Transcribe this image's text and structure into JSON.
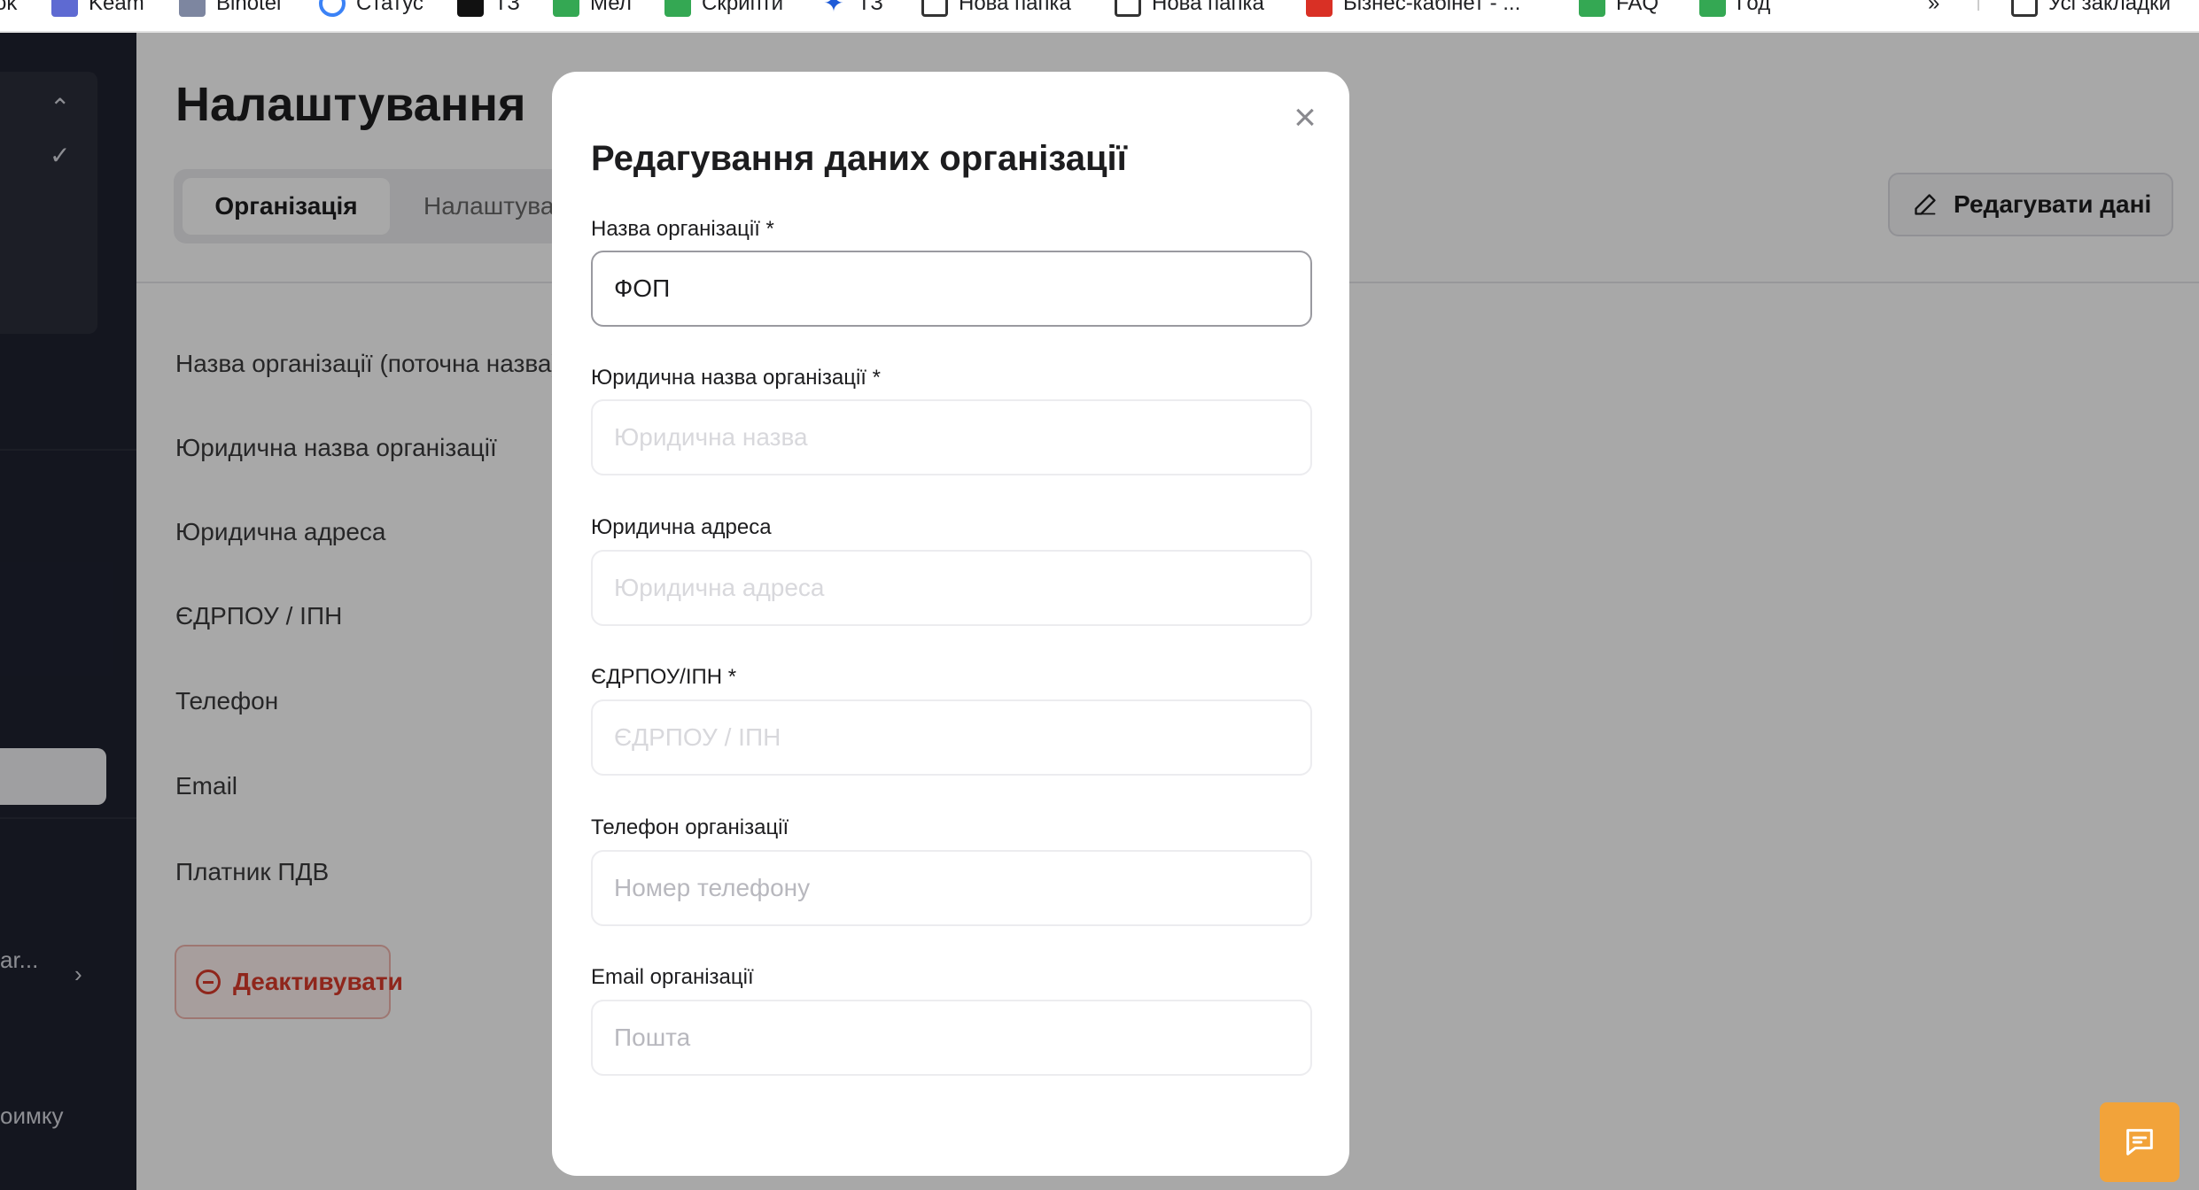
{
  "bookmarks": [
    {
      "label": "ok",
      "icon": "none"
    },
    {
      "label": "Keam",
      "icon": "blue-square-icon"
    },
    {
      "label": "Binotel",
      "icon": "grey-square-icon"
    },
    {
      "label": "Статус",
      "icon": "circle-icon"
    },
    {
      "label": "ТЗ",
      "icon": "black-square-icon"
    },
    {
      "label": "Мел",
      "icon": "green-sheet-icon"
    },
    {
      "label": "Скрипти",
      "icon": "green-sheet-icon"
    },
    {
      "label": "ТЗ",
      "icon": "star-icon"
    },
    {
      "label": "Нова папка",
      "icon": "folder-icon"
    },
    {
      "label": "Нова папка",
      "icon": "folder-icon"
    },
    {
      "label": "Бізнес-кабінет - ...",
      "icon": "red-icon"
    },
    {
      "label": "FAQ",
      "icon": "green-sheet-icon"
    },
    {
      "label": "Год",
      "icon": "green-sheet-icon"
    },
    {
      "label": "»",
      "icon": "none"
    },
    {
      "label": "Усі закладки",
      "icon": "folder-icon"
    }
  ],
  "sidebar": {
    "org_item": "ar...",
    "support_item": "оимку"
  },
  "page": {
    "title": "Налаштування",
    "tabs": [
      "Організація",
      "Налаштування"
    ],
    "edit_button": "Редагувати дані",
    "info_labels": [
      "Назва організації (поточна назва)",
      "Юридична назва організації",
      "Юридична адреса",
      "ЄДРПОУ / ІПН",
      "Телефон",
      "Email",
      "Платник ПДВ"
    ],
    "deactivate_button": "Деактивувати"
  },
  "modal": {
    "title": "Редагування даних організації",
    "close": "×",
    "fields": [
      {
        "label": "Назва організації *",
        "value": "ФОП",
        "placeholder": ""
      },
      {
        "label": "Юридична назва організації *",
        "value": "",
        "placeholder": "Юридична назва"
      },
      {
        "label": "Юридична адреса",
        "value": "",
        "placeholder": "Юридична адреса"
      },
      {
        "label": "ЄДРПОУ/ІПН *",
        "value": "",
        "placeholder": "ЄДРПОУ / ІПН"
      },
      {
        "label": "Телефон організації",
        "value": "",
        "placeholder": "Номер телефону"
      },
      {
        "label": "Email організації",
        "value": "",
        "placeholder": "Пошта"
      }
    ]
  },
  "colors": {
    "accent_orange": "#f2a33a",
    "danger_red": "#d93b2b",
    "sidebar_dark": "#1f2230"
  }
}
